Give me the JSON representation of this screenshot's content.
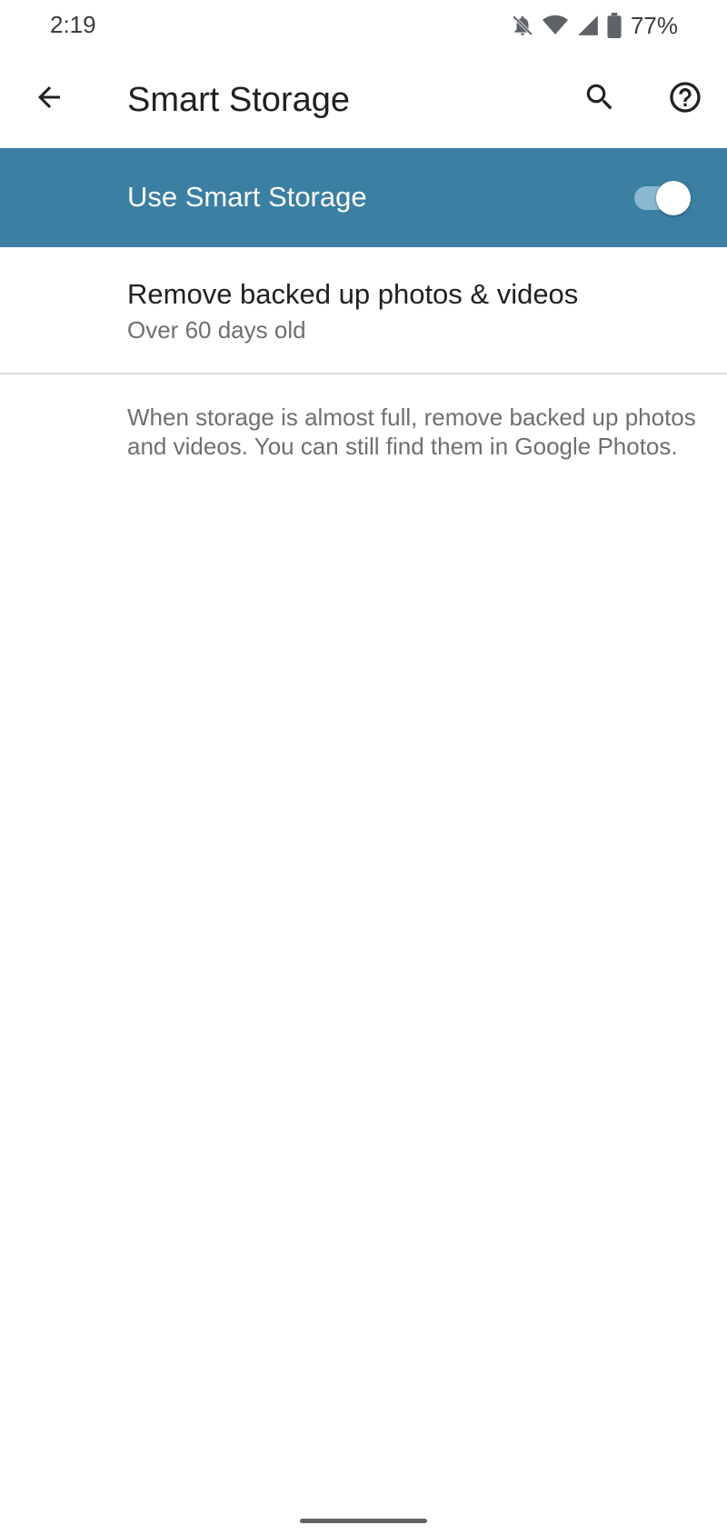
{
  "status_bar": {
    "time": "2:19",
    "battery_percent": "77%",
    "icons": [
      "notifications-off-icon",
      "wifi-icon",
      "cellular-signal-icon",
      "battery-icon"
    ]
  },
  "app_bar": {
    "title": "Smart Storage",
    "back_icon": "arrow-back-icon",
    "search_icon": "search-icon",
    "help_icon": "help-circle-icon"
  },
  "master_switch": {
    "label": "Use Smart Storage",
    "checked": true,
    "background_color": "#3b7fa3"
  },
  "preference": {
    "title": "Remove backed up photos & videos",
    "summary": "Over 60 days old"
  },
  "footer": {
    "text": "When storage is almost full, remove backed up photos and videos. You can still find them in Google Photos."
  }
}
